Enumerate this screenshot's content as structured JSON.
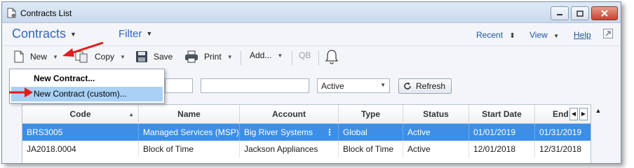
{
  "window": {
    "title": "Contracts List"
  },
  "menubar": {
    "main_menu": "Contracts",
    "filter_menu": "Filter",
    "recent": "Recent",
    "view": "View",
    "help": "Help"
  },
  "toolbar": {
    "new": "New",
    "copy": "Copy",
    "save": "Save",
    "print": "Print",
    "add": "Add...",
    "qb": "QB"
  },
  "new_menu": {
    "items": [
      "New Contract...",
      "New Contract (custom)..."
    ]
  },
  "filters": {
    "status_select": "Active",
    "refresh": "Refresh"
  },
  "grid": {
    "columns": [
      "Code",
      "Name",
      "Account",
      "Type",
      "Status",
      "Start Date",
      "End"
    ],
    "rows": [
      [
        "BRS3005",
        "Managed Services (MSP)",
        "Big River Systems",
        "Global",
        "Active",
        "01/01/2019",
        "01/31/2019"
      ],
      [
        "JA2018.0004",
        "Block of Time",
        "Jackson Appliances",
        "Block of Time",
        "Active",
        "12/01/2018",
        "12/31/2018"
      ]
    ]
  },
  "colors": {
    "accent_blue": "#3366bb",
    "selected_row": "#3d8ee6",
    "menu_highlight": "#a9d1f5",
    "annotation_red": "#e21b1b"
  }
}
